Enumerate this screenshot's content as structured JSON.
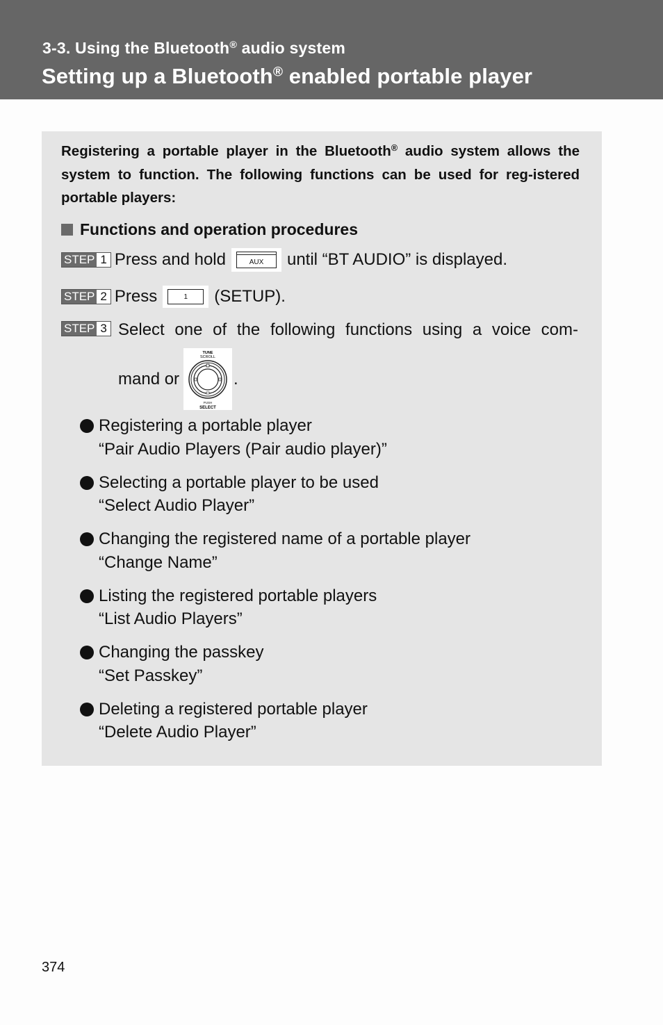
{
  "header": {
    "section_prefix": "3-3. Using the Bluetooth",
    "section_suffix": " audio system",
    "title_prefix": "Setting up a Bluetooth",
    "title_suffix": " enabled portable player",
    "registered_mark": "®",
    "background_color": "#666666"
  },
  "content": {
    "background_color": "#e5e5e5",
    "intro_prefix": "Registering a portable player in the Bluetooth",
    "intro_suffix": " audio system allows the system to function. The following functions can be used for reg-istered portable players:",
    "subheading": "Functions and operation procedures",
    "steps": [
      {
        "label": "STEP",
        "number": "1",
        "text_before": "Press and hold",
        "button_label": "AUX",
        "text_after": "until “BT AUDIO” is displayed."
      },
      {
        "label": "STEP",
        "number": "2",
        "text_before": "Press",
        "button_label": "1",
        "text_after": "(SETUP)."
      },
      {
        "label": "STEP",
        "number": "3",
        "text_line1": "Select one of the following functions using a voice com-",
        "text_line2": "mand or",
        "knob_top_label_1": "TUNE",
        "knob_top_label_2": "SCROLL",
        "knob_bottom_label_1": "PUSH",
        "knob_bottom_label_2": "SELECT",
        "text_end": "."
      }
    ],
    "functions": [
      {
        "description": "Registering a portable player",
        "command": "“Pair Audio Players (Pair audio player)”"
      },
      {
        "description": "Selecting a portable player to be used",
        "command": "“Select Audio Player”"
      },
      {
        "description": "Changing the registered name of a portable player",
        "command": "“Change Name”"
      },
      {
        "description": "Listing the registered portable players",
        "command": "“List Audio Players”"
      },
      {
        "description": "Changing the passkey",
        "command": "“Set Passkey”"
      },
      {
        "description": "Deleting a registered portable player",
        "command": "“Delete Audio Player”"
      }
    ]
  },
  "footer": {
    "page_number": "374"
  }
}
